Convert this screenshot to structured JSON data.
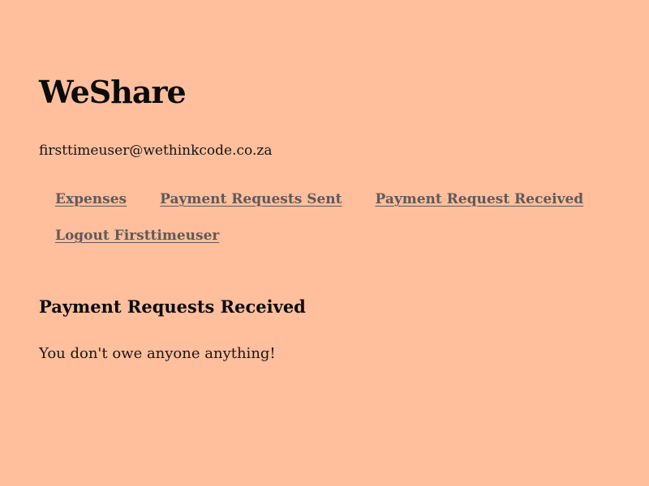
{
  "app": {
    "title": "WeShare"
  },
  "user": {
    "email": "firsttimeuser@wethinkcode.co.za"
  },
  "nav": {
    "items": [
      {
        "label": "Expenses"
      },
      {
        "label": "Payment Requests Sent"
      },
      {
        "label": "Payment Request Received"
      }
    ],
    "logout_label": "Logout Firsttimeuser"
  },
  "main": {
    "section_title": "Payment Requests Received",
    "empty_message": "You don't owe anyone anything!"
  },
  "colors": {
    "background": "#ffbe9c",
    "text": "#111111",
    "link": "#5f5a5a"
  }
}
